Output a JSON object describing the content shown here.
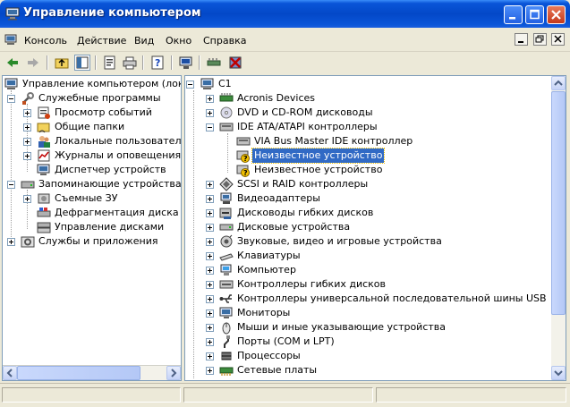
{
  "window": {
    "title": "Управление компьютером"
  },
  "menu": {
    "items": [
      "Консоль",
      "Действие",
      "Вид",
      "Окно",
      "Справка"
    ]
  },
  "left_tree": {
    "root": "Управление компьютером (локаль",
    "system_tools": "Служебные программы",
    "event_viewer": "Просмотр событий",
    "shared_folders": "Общие папки",
    "local_users": "Локальные пользователи и",
    "perf_logs": "Журналы и оповещения пр",
    "device_manager": "Диспетчер устройств",
    "storage": "Запоминающие устройства",
    "removable": "Съемные ЗУ",
    "defrag": "Дефрагментация диска",
    "disk_mgmt": "Управление дисками",
    "services": "Службы и приложения"
  },
  "right_tree": {
    "root": "C1",
    "items": [
      "Acronis Devices",
      "DVD и CD-ROM дисководы",
      "IDE ATA/ATAPI контроллеры",
      "VIA Bus Master IDE контроллер",
      "Неизвестное устройство",
      "Неизвестное устройство",
      "SCSI и RAID контроллеры",
      "Видеоадаптеры",
      "Дисководы гибких дисков",
      "Дисковые устройства",
      "Звуковые, видео и игровые устройства",
      "Клавиатуры",
      "Компьютер",
      "Контроллеры гибких дисков",
      "Контроллеры универсальной последовательной шины USB",
      "Мониторы",
      "Мыши и иные указывающие устройства",
      "Порты (COM и LPT)",
      "Процессоры",
      "Сетевые платы"
    ]
  },
  "colors": {
    "title_blue": "#0348c8",
    "selection": "#316ac5",
    "warning": "#f0c000"
  }
}
